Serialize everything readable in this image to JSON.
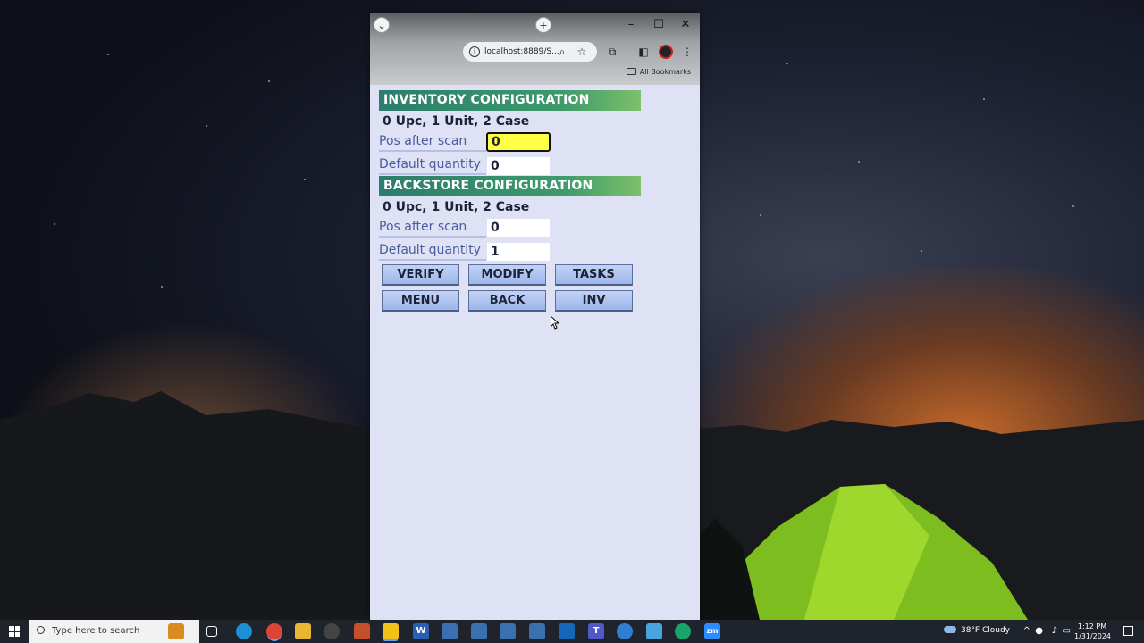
{
  "browser": {
    "address": "localhost:8889/S...",
    "bookmarks_all": "All Bookmarks",
    "window_controls": {
      "minimize": "–",
      "maximize": "☐",
      "close": "✕"
    }
  },
  "inventory": {
    "header": "INVENTORY CONFIGURATION",
    "legend": "0 Upc, 1 Unit, 2 Case",
    "pos_after_scan_label": "Pos after scan",
    "pos_after_scan_value": "0",
    "default_quantity_label": "Default quantity",
    "default_quantity_value": "0"
  },
  "backstore": {
    "header": "BACKSTORE CONFIGURATION",
    "legend": "0 Upc, 1 Unit, 2 Case",
    "pos_after_scan_label": "Pos after scan",
    "pos_after_scan_value": "0",
    "default_quantity_label": "Default quantity",
    "default_quantity_value": "1"
  },
  "buttons": {
    "verify": "VERIFY",
    "modify": "MODIFY",
    "tasks": "TASKS",
    "menu": "MENU",
    "back": "BACK",
    "inv": "INV"
  },
  "taskbar": {
    "search_placeholder": "Type here to search",
    "weather": "38°F  Cloudy",
    "time": "1:12 PM",
    "date": "1/31/2024"
  },
  "colors": {
    "section_header": "#2b7d6d",
    "active_input": "#ffff44",
    "page_background": "#dfe2f5",
    "button": "#a9c0ee"
  }
}
